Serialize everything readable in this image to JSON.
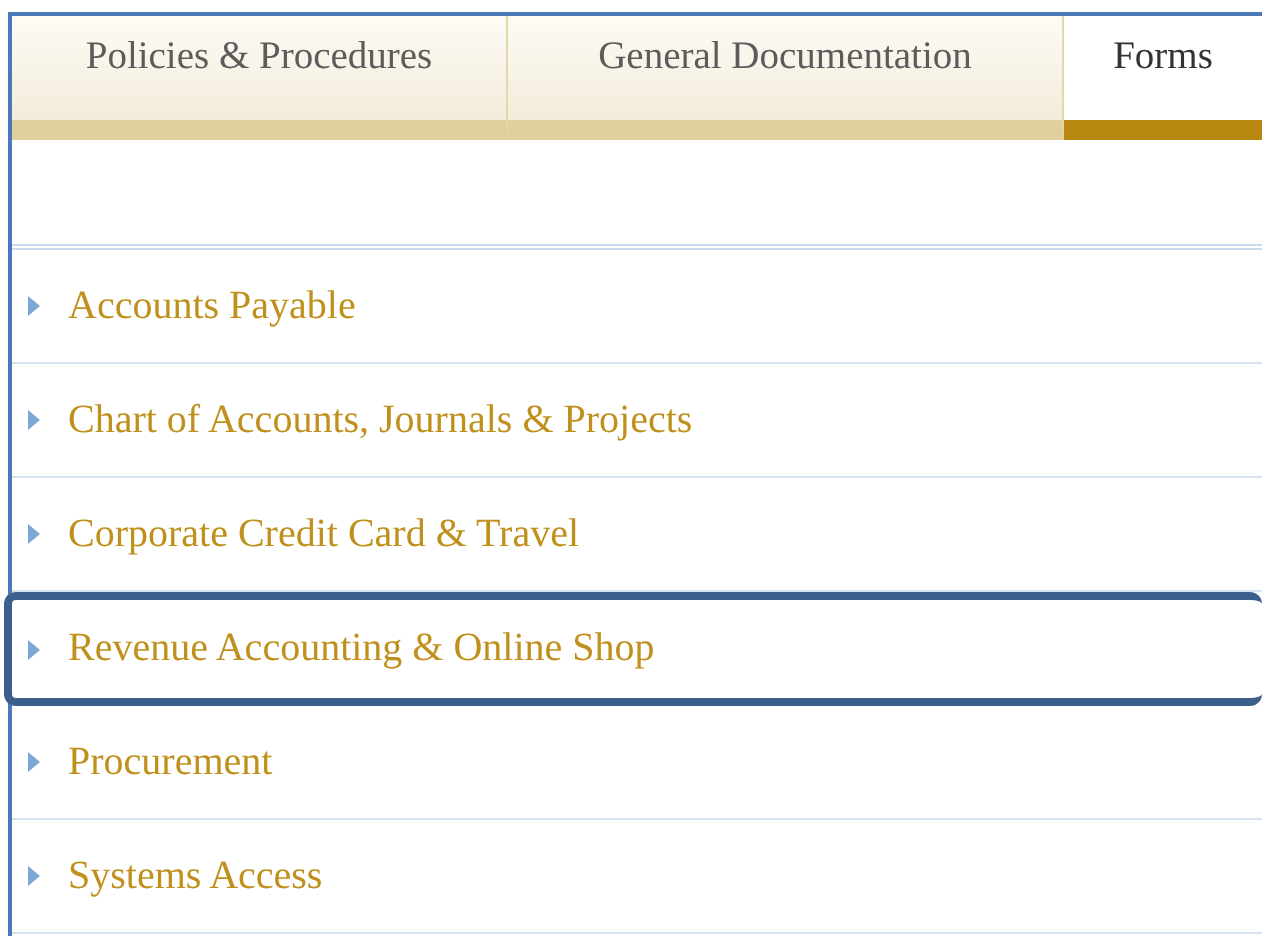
{
  "tabs": [
    {
      "label": "Policies & Procedures",
      "selected": false
    },
    {
      "label": "General Documentation",
      "selected": false
    },
    {
      "label": "Forms",
      "selected": true
    }
  ],
  "categories": [
    {
      "label": "Accounts Payable",
      "highlighted": false
    },
    {
      "label": "Chart of Accounts, Journals & Projects",
      "highlighted": false
    },
    {
      "label": "Corporate Credit Card & Travel",
      "highlighted": false
    },
    {
      "label": "Revenue Accounting & Online Shop",
      "highlighted": true
    },
    {
      "label": "Procurement",
      "highlighted": false
    },
    {
      "label": "Systems Access",
      "highlighted": false
    }
  ]
}
